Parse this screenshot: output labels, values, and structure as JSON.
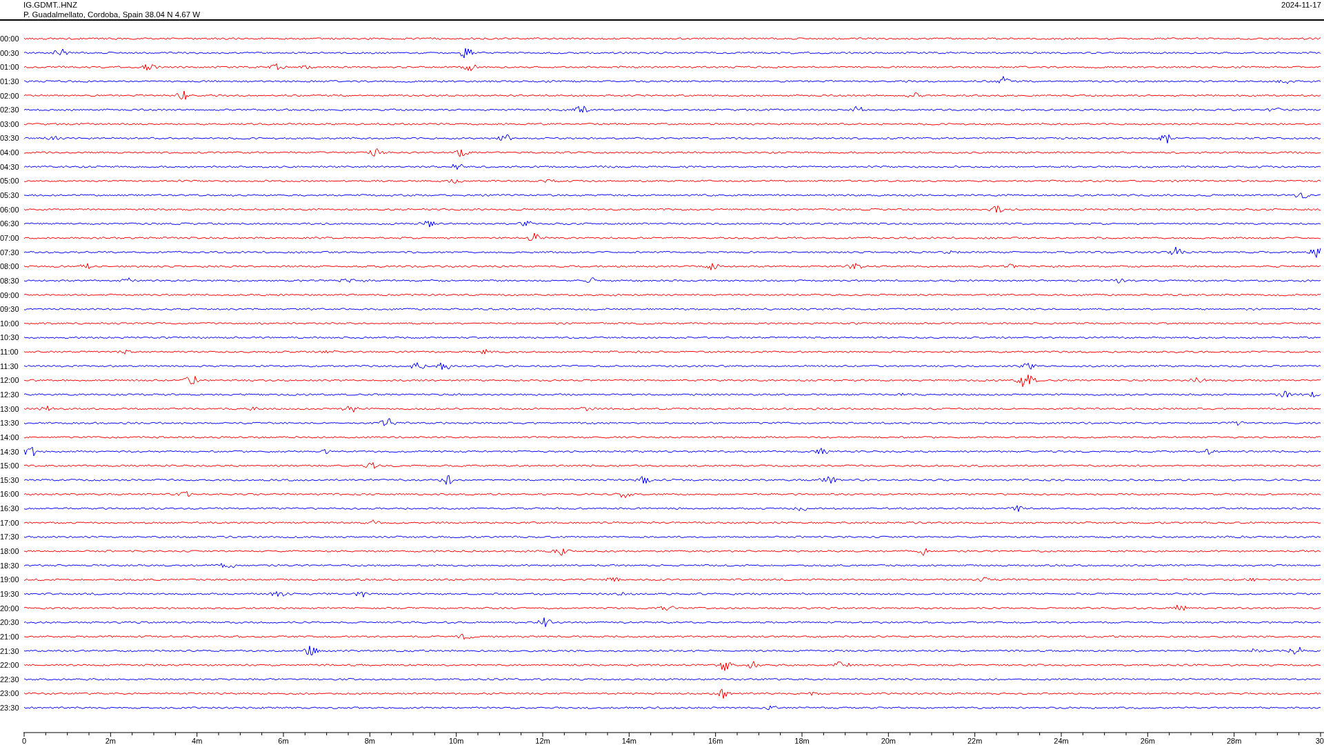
{
  "header": {
    "station": "IG.GDMT..HNZ",
    "location": "P. Guadalmellato, Cordoba, Spain  38.04 N 4.67 W",
    "date": "2024-11-17"
  },
  "traces": [
    {
      "label": "00:00",
      "color": "#ff0000"
    },
    {
      "label": "00:30",
      "color": "#0000ff"
    },
    {
      "label": "01:00",
      "color": "#ff0000"
    },
    {
      "label": "01:30",
      "color": "#0000ff"
    },
    {
      "label": "02:00",
      "color": "#ff0000"
    },
    {
      "label": "02:30",
      "color": "#0000ff"
    },
    {
      "label": "03:00",
      "color": "#ff0000"
    },
    {
      "label": "03:30",
      "color": "#0000ff"
    },
    {
      "label": "04:00",
      "color": "#ff0000"
    },
    {
      "label": "04:30",
      "color": "#0000ff"
    },
    {
      "label": "05:00",
      "color": "#ff0000"
    },
    {
      "label": "05:30",
      "color": "#0000ff"
    },
    {
      "label": "06:00",
      "color": "#ff0000"
    },
    {
      "label": "06:30",
      "color": "#0000ff"
    },
    {
      "label": "07:00",
      "color": "#ff0000"
    },
    {
      "label": "07:30",
      "color": "#0000ff"
    },
    {
      "label": "08:00",
      "color": "#ff0000"
    },
    {
      "label": "08:30",
      "color": "#0000ff"
    },
    {
      "label": "09:00",
      "color": "#ff0000"
    },
    {
      "label": "09:30",
      "color": "#0000ff"
    },
    {
      "label": "10:00",
      "color": "#ff0000"
    },
    {
      "label": "10:30",
      "color": "#0000ff"
    },
    {
      "label": "11:00",
      "color": "#ff0000"
    },
    {
      "label": "11:30",
      "color": "#0000ff"
    },
    {
      "label": "12:00",
      "color": "#ff0000"
    },
    {
      "label": "12:30",
      "color": "#0000ff"
    },
    {
      "label": "13:00",
      "color": "#ff0000"
    },
    {
      "label": "13:30",
      "color": "#0000ff"
    },
    {
      "label": "14:00",
      "color": "#ff0000"
    },
    {
      "label": "14:30",
      "color": "#0000ff"
    },
    {
      "label": "15:00",
      "color": "#ff0000"
    },
    {
      "label": "15:30",
      "color": "#0000ff"
    },
    {
      "label": "16:00",
      "color": "#ff0000"
    },
    {
      "label": "16:30",
      "color": "#0000ff"
    },
    {
      "label": "17:00",
      "color": "#ff0000"
    },
    {
      "label": "17:30",
      "color": "#0000ff"
    },
    {
      "label": "18:00",
      "color": "#ff0000"
    },
    {
      "label": "18:30",
      "color": "#0000ff"
    },
    {
      "label": "19:00",
      "color": "#ff0000"
    },
    {
      "label": "19:30",
      "color": "#0000ff"
    },
    {
      "label": "20:00",
      "color": "#ff0000"
    },
    {
      "label": "20:30",
      "color": "#0000ff"
    },
    {
      "label": "21:00",
      "color": "#ff0000"
    },
    {
      "label": "21:30",
      "color": "#0000ff"
    },
    {
      "label": "22:00",
      "color": "#ff0000"
    },
    {
      "label": "22:30",
      "color": "#0000ff"
    },
    {
      "label": "23:00",
      "color": "#ff0000"
    },
    {
      "label": "23:30",
      "color": "#0000ff"
    }
  ],
  "axis": {
    "ticks": [
      "0",
      "2m",
      "4m",
      "6m",
      "8m",
      "10m",
      "12m",
      "14m",
      "16m",
      "18m",
      "20m",
      "22m",
      "24m",
      "26m",
      "28m",
      "30"
    ]
  }
}
